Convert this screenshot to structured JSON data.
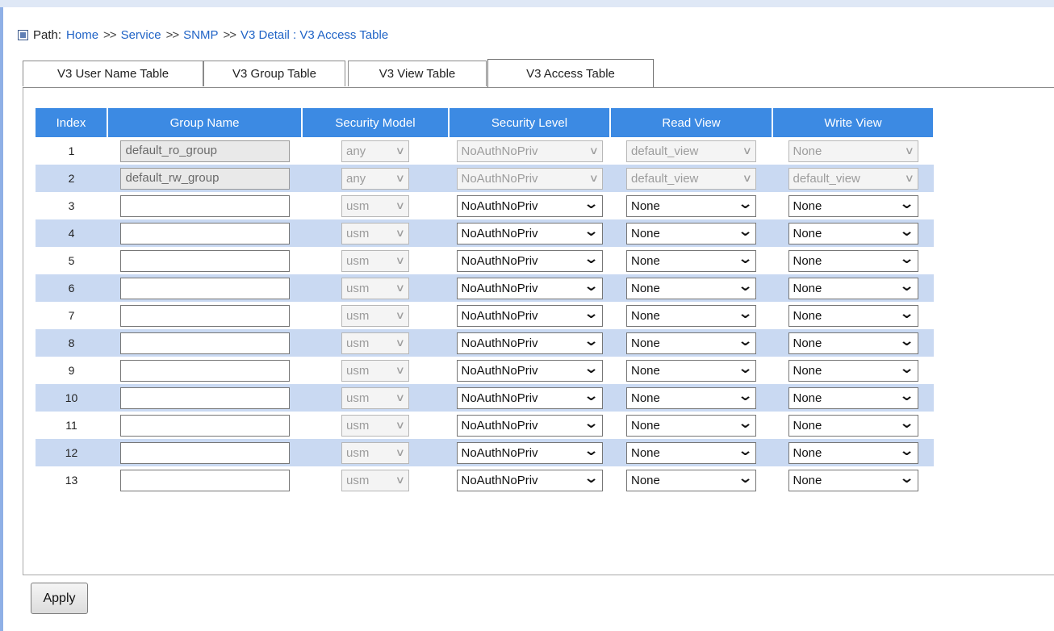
{
  "path": {
    "label": "Path:",
    "separator": ">>",
    "crumbs": [
      "Home",
      "Service",
      "SNMP",
      "V3 Detail : V3 Access Table"
    ]
  },
  "tabs": [
    {
      "label": "V3 User Name Table",
      "active": false
    },
    {
      "label": "V3 Group Table",
      "active": false
    },
    {
      "label": "V3 View Table",
      "active": false
    },
    {
      "label": "V3 Access Table",
      "active": true
    }
  ],
  "table": {
    "headers": [
      "Index",
      "Group Name",
      "Security Model",
      "Security Level",
      "Read View",
      "Write View"
    ],
    "rows": [
      {
        "index": "1",
        "group_name": "default_ro_group",
        "security_model": "any",
        "security_level": "NoAuthNoPriv",
        "read_view": "default_view",
        "write_view": "None",
        "editable": false
      },
      {
        "index": "2",
        "group_name": "default_rw_group",
        "security_model": "any",
        "security_level": "NoAuthNoPriv",
        "read_view": "default_view",
        "write_view": "default_view",
        "editable": false
      },
      {
        "index": "3",
        "group_name": "",
        "security_model": "usm",
        "security_level": "NoAuthNoPriv",
        "read_view": "None",
        "write_view": "None",
        "editable": true
      },
      {
        "index": "4",
        "group_name": "",
        "security_model": "usm",
        "security_level": "NoAuthNoPriv",
        "read_view": "None",
        "write_view": "None",
        "editable": true
      },
      {
        "index": "5",
        "group_name": "",
        "security_model": "usm",
        "security_level": "NoAuthNoPriv",
        "read_view": "None",
        "write_view": "None",
        "editable": true
      },
      {
        "index": "6",
        "group_name": "",
        "security_model": "usm",
        "security_level": "NoAuthNoPriv",
        "read_view": "None",
        "write_view": "None",
        "editable": true
      },
      {
        "index": "7",
        "group_name": "",
        "security_model": "usm",
        "security_level": "NoAuthNoPriv",
        "read_view": "None",
        "write_view": "None",
        "editable": true
      },
      {
        "index": "8",
        "group_name": "",
        "security_model": "usm",
        "security_level": "NoAuthNoPriv",
        "read_view": "None",
        "write_view": "None",
        "editable": true
      },
      {
        "index": "9",
        "group_name": "",
        "security_model": "usm",
        "security_level": "NoAuthNoPriv",
        "read_view": "None",
        "write_view": "None",
        "editable": true
      },
      {
        "index": "10",
        "group_name": "",
        "security_model": "usm",
        "security_level": "NoAuthNoPriv",
        "read_view": "None",
        "write_view": "None",
        "editable": true
      },
      {
        "index": "11",
        "group_name": "",
        "security_model": "usm",
        "security_level": "NoAuthNoPriv",
        "read_view": "None",
        "write_view": "None",
        "editable": true
      },
      {
        "index": "12",
        "group_name": "",
        "security_model": "usm",
        "security_level": "NoAuthNoPriv",
        "read_view": "None",
        "write_view": "None",
        "editable": true
      },
      {
        "index": "13",
        "group_name": "",
        "security_model": "usm",
        "security_level": "NoAuthNoPriv",
        "read_view": "None",
        "write_view": "None",
        "editable": true
      }
    ]
  },
  "apply_label": "Apply",
  "icons": {
    "path": "square-bullet-icon",
    "dropdown": "chevron-down-icon"
  },
  "colors": {
    "header_bg": "#3c8ae3",
    "row_alt_bg": "#c9d9f2",
    "link": "#1f63c6"
  }
}
